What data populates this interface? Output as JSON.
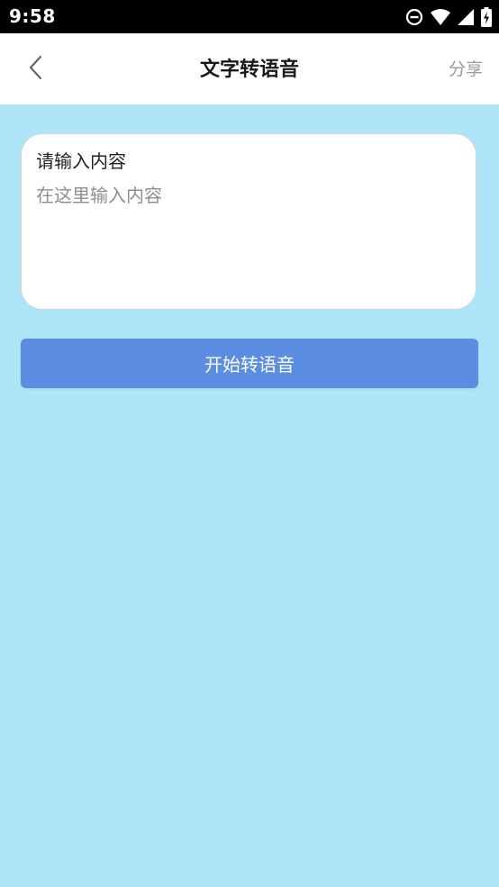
{
  "status_bar": {
    "time": "9:58",
    "icons": [
      "do-not-disturb-icon",
      "wifi-icon",
      "cell-signal-icon",
      "battery-charging-icon"
    ]
  },
  "header": {
    "title": "文字转语音",
    "share_label": "分享",
    "back_icon": "chevron-left-icon"
  },
  "input": {
    "label": "请输入内容",
    "placeholder": "在这里输入内容",
    "value": ""
  },
  "actions": {
    "start_label": "开始转语音"
  },
  "colors": {
    "page_background": "#ade4f8",
    "button": "#5b8de2",
    "header_background": "#ffffff"
  }
}
